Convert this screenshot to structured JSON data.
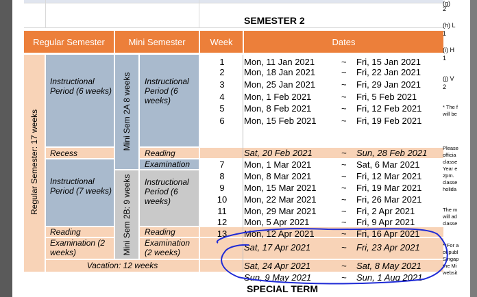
{
  "section_title": "SEMESTER 2",
  "next_section_title": "SPECIAL TERM",
  "headers": {
    "regular": "Regular Semester",
    "mini": "Mini Semester",
    "week": "Week",
    "dates": "Dates"
  },
  "regular_vertical": "Regular Semester: 17 weeks",
  "mini_2a_vertical": "Mini Sem 2A 8 weeks",
  "mini_2b_vertical": "Mini Sem 2B: 9 weeks",
  "blocks": {
    "instr1_reg": "Instructional Period (6 weeks)",
    "instr1_mini": "Instructional Period (6 weeks)",
    "recess": "Recess",
    "reading1": "Reading",
    "examination1": "Examination",
    "instr2_reg": "Instructional Period (7 weeks)",
    "instr2_mini": "Instructional Period (6 weeks)",
    "reading2_reg": "Reading",
    "reading2_mini": "Reading",
    "exam2_reg": "Examination (2 weeks)",
    "exam2_mini": "Examination (2 weeks)",
    "vacation": "Vacation: 12 weeks"
  },
  "tilde": "~",
  "rows": [
    {
      "week": "1",
      "start": "Mon, 11 Jan 2021",
      "end": "Fri, 15 Jan 2021"
    },
    {
      "week": "2",
      "start": "Mon, 18 Jan 2021",
      "end": "Fri, 22 Jan 2021"
    },
    {
      "week": "3",
      "start": "Mon, 25 Jan 2021",
      "end": "Fri, 29 Jan 2021"
    },
    {
      "week": "4",
      "start": "Mon, 1 Feb 2021",
      "end": "Fri, 5 Feb 2021"
    },
    {
      "week": "5",
      "start": "Mon, 8 Feb 2021",
      "end": "Fri, 12 Feb 2021"
    },
    {
      "week": "6",
      "start": "Mon, 15 Feb 2021",
      "end": "Fri, 19 Feb 2021"
    },
    {
      "week": "",
      "start": "Sat, 20 Feb 2021",
      "end": "Sun, 28 Feb 2021"
    },
    {
      "week": "7",
      "start": "Mon, 1 Mar 2021",
      "end": "Sat, 6 Mar 2021"
    },
    {
      "week": "8",
      "start": "Mon, 8 Mar 2021",
      "end": "Fri, 12 Mar 2021"
    },
    {
      "week": "9",
      "start": "Mon, 15 Mar 2021",
      "end": "Fri, 19 Mar 2021"
    },
    {
      "week": "10",
      "start": "Mon, 22 Mar 2021",
      "end": "Fri, 26 Mar 2021"
    },
    {
      "week": "11",
      "start": "Mon, 29 Mar 2021",
      "end": "Fri, 2 Apr 2021"
    },
    {
      "week": "12",
      "start": "Mon, 5 Apr 2021",
      "end": "Fri, 9 Apr 2021"
    },
    {
      "week": "13",
      "start": "Mon, 12 Apr 2021",
      "end": "Fri, 16 Apr 2021"
    },
    {
      "week": "",
      "start": "Sat, 17 Apr 2021",
      "end": "Fri, 23 Apr 2021"
    },
    {
      "week": "",
      "start": "Sat, 24 Apr 2021",
      "end": "Sat, 8 May 2021"
    },
    {
      "week": "",
      "start": "Sun, 9 May 2021",
      "end": "Sun, 1 Aug 2021"
    }
  ],
  "side_notes": [
    "(g)",
    "2",
    "(h) L",
    "1",
    "(i) H",
    "1",
    "(j) V",
    "2",
    "* The f",
    "will be",
    "Please",
    "officia",
    "classe",
    "Year e",
    "2pm.",
    "classe",
    "holida",
    "The m",
    "will ad",
    "classe",
    "**For a",
    "of publ",
    "Singap",
    "the Mi",
    "websit"
  ],
  "colors": {
    "orange": "#ec7f3a",
    "peach": "#f8d3b7",
    "blue": "#a9bacd",
    "gray": "#c9c9c9",
    "annotation": "#1f2bd6"
  }
}
